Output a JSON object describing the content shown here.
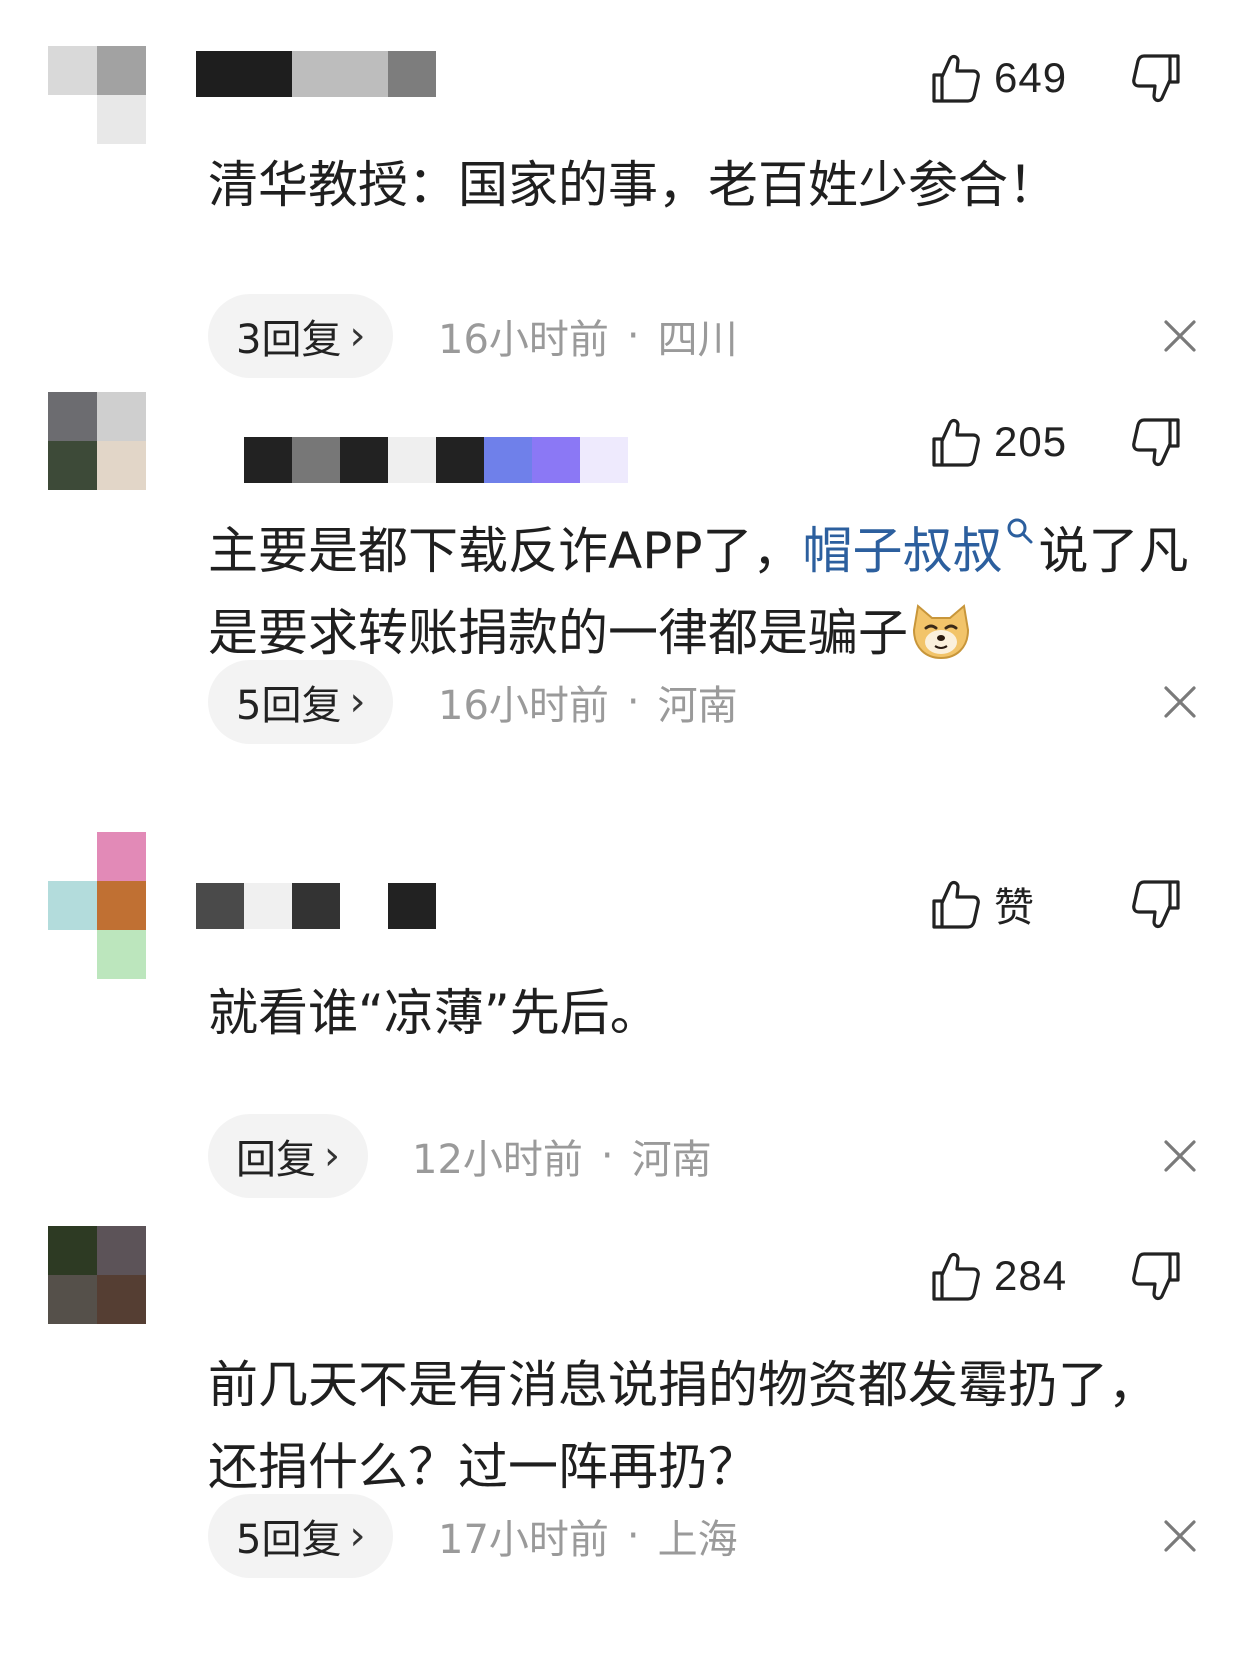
{
  "comments": [
    {
      "likes": "649",
      "text": "清华教授：国家的事，老百姓少参合！",
      "reply_label": "3回复",
      "time": "16小时前",
      "location": "四川"
    },
    {
      "likes": "205",
      "text_before": "主要是都下载反诈APP了，",
      "mention": "帽子叔叔",
      "text_after": "说了凡是要求转账捐款的一律都是骗子",
      "reply_label": "5回复",
      "time": "16小时前",
      "location": "河南"
    },
    {
      "likes": "赞",
      "text": "就看谁“凉薄”先后。",
      "reply_label": "回复",
      "time": "12小时前",
      "location": "河南"
    },
    {
      "likes": "284",
      "text": "前几天不是有消息说捐的物资都发霉扔了，还捐什么？过一阵再扔？",
      "reply_label": "5回复",
      "time": "17小时前",
      "location": "上海"
    }
  ],
  "separator": "·",
  "chevron": "›",
  "icons": {
    "like": "thumbs-up-icon",
    "dislike": "thumbs-down-icon",
    "close": "close-icon",
    "mention_search": "search-icon",
    "emoji": "doge-emoji-icon"
  },
  "colors": {
    "mention": "#2c5f9e",
    "meta_text": "#9a9a9a",
    "pill_bg": "#f3f3f3"
  }
}
